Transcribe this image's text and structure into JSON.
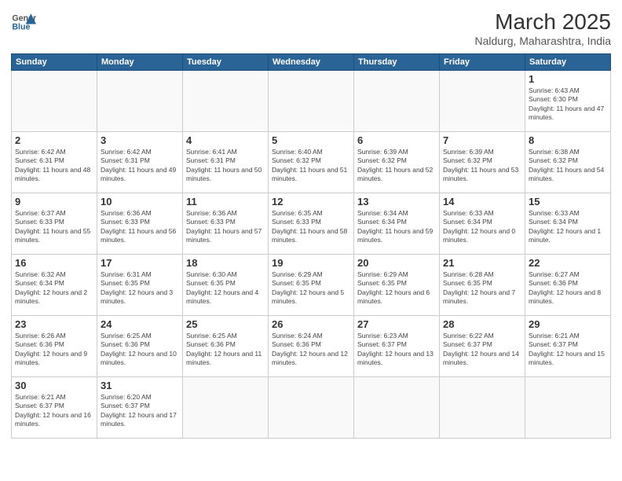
{
  "header": {
    "logo_general": "General",
    "logo_blue": "Blue",
    "month_year": "March 2025",
    "location": "Naldurg, Maharashtra, India"
  },
  "days_of_week": [
    "Sunday",
    "Monday",
    "Tuesday",
    "Wednesday",
    "Thursday",
    "Friday",
    "Saturday"
  ],
  "weeks": [
    [
      {
        "day": "",
        "empty": true
      },
      {
        "day": "",
        "empty": true
      },
      {
        "day": "",
        "empty": true
      },
      {
        "day": "",
        "empty": true
      },
      {
        "day": "",
        "empty": true
      },
      {
        "day": "",
        "empty": true
      },
      {
        "day": "1",
        "sunrise": "6:43 AM",
        "sunset": "6:30 PM",
        "daylight": "11 hours and 47 minutes."
      }
    ],
    [
      {
        "day": "2",
        "sunrise": "6:42 AM",
        "sunset": "6:31 PM",
        "daylight": "11 hours and 48 minutes."
      },
      {
        "day": "3",
        "sunrise": "6:42 AM",
        "sunset": "6:31 PM",
        "daylight": "11 hours and 49 minutes."
      },
      {
        "day": "4",
        "sunrise": "6:41 AM",
        "sunset": "6:31 PM",
        "daylight": "11 hours and 50 minutes."
      },
      {
        "day": "5",
        "sunrise": "6:40 AM",
        "sunset": "6:32 PM",
        "daylight": "11 hours and 51 minutes."
      },
      {
        "day": "6",
        "sunrise": "6:39 AM",
        "sunset": "6:32 PM",
        "daylight": "11 hours and 52 minutes."
      },
      {
        "day": "7",
        "sunrise": "6:39 AM",
        "sunset": "6:32 PM",
        "daylight": "11 hours and 53 minutes."
      },
      {
        "day": "8",
        "sunrise": "6:38 AM",
        "sunset": "6:32 PM",
        "daylight": "11 hours and 54 minutes."
      }
    ],
    [
      {
        "day": "9",
        "sunrise": "6:37 AM",
        "sunset": "6:33 PM",
        "daylight": "11 hours and 55 minutes."
      },
      {
        "day": "10",
        "sunrise": "6:36 AM",
        "sunset": "6:33 PM",
        "daylight": "11 hours and 56 minutes."
      },
      {
        "day": "11",
        "sunrise": "6:36 AM",
        "sunset": "6:33 PM",
        "daylight": "11 hours and 57 minutes."
      },
      {
        "day": "12",
        "sunrise": "6:35 AM",
        "sunset": "6:33 PM",
        "daylight": "11 hours and 58 minutes."
      },
      {
        "day": "13",
        "sunrise": "6:34 AM",
        "sunset": "6:34 PM",
        "daylight": "11 hours and 59 minutes."
      },
      {
        "day": "14",
        "sunrise": "6:33 AM",
        "sunset": "6:34 PM",
        "daylight": "12 hours and 0 minutes."
      },
      {
        "day": "15",
        "sunrise": "6:33 AM",
        "sunset": "6:34 PM",
        "daylight": "12 hours and 1 minute."
      }
    ],
    [
      {
        "day": "16",
        "sunrise": "6:32 AM",
        "sunset": "6:34 PM",
        "daylight": "12 hours and 2 minutes."
      },
      {
        "day": "17",
        "sunrise": "6:31 AM",
        "sunset": "6:35 PM",
        "daylight": "12 hours and 3 minutes."
      },
      {
        "day": "18",
        "sunrise": "6:30 AM",
        "sunset": "6:35 PM",
        "daylight": "12 hours and 4 minutes."
      },
      {
        "day": "19",
        "sunrise": "6:29 AM",
        "sunset": "6:35 PM",
        "daylight": "12 hours and 5 minutes."
      },
      {
        "day": "20",
        "sunrise": "6:29 AM",
        "sunset": "6:35 PM",
        "daylight": "12 hours and 6 minutes."
      },
      {
        "day": "21",
        "sunrise": "6:28 AM",
        "sunset": "6:35 PM",
        "daylight": "12 hours and 7 minutes."
      },
      {
        "day": "22",
        "sunrise": "6:27 AM",
        "sunset": "6:36 PM",
        "daylight": "12 hours and 8 minutes."
      }
    ],
    [
      {
        "day": "23",
        "sunrise": "6:26 AM",
        "sunset": "6:36 PM",
        "daylight": "12 hours and 9 minutes."
      },
      {
        "day": "24",
        "sunrise": "6:25 AM",
        "sunset": "6:36 PM",
        "daylight": "12 hours and 10 minutes."
      },
      {
        "day": "25",
        "sunrise": "6:25 AM",
        "sunset": "6:36 PM",
        "daylight": "12 hours and 11 minutes."
      },
      {
        "day": "26",
        "sunrise": "6:24 AM",
        "sunset": "6:36 PM",
        "daylight": "12 hours and 12 minutes."
      },
      {
        "day": "27",
        "sunrise": "6:23 AM",
        "sunset": "6:37 PM",
        "daylight": "12 hours and 13 minutes."
      },
      {
        "day": "28",
        "sunrise": "6:22 AM",
        "sunset": "6:37 PM",
        "daylight": "12 hours and 14 minutes."
      },
      {
        "day": "29",
        "sunrise": "6:21 AM",
        "sunset": "6:37 PM",
        "daylight": "12 hours and 15 minutes."
      }
    ],
    [
      {
        "day": "30",
        "sunrise": "6:21 AM",
        "sunset": "6:37 PM",
        "daylight": "12 hours and 16 minutes."
      },
      {
        "day": "31",
        "sunrise": "6:20 AM",
        "sunset": "6:37 PM",
        "daylight": "12 hours and 17 minutes."
      },
      {
        "day": "",
        "empty": true
      },
      {
        "day": "",
        "empty": true
      },
      {
        "day": "",
        "empty": true
      },
      {
        "day": "",
        "empty": true
      },
      {
        "day": "",
        "empty": true
      }
    ]
  ]
}
